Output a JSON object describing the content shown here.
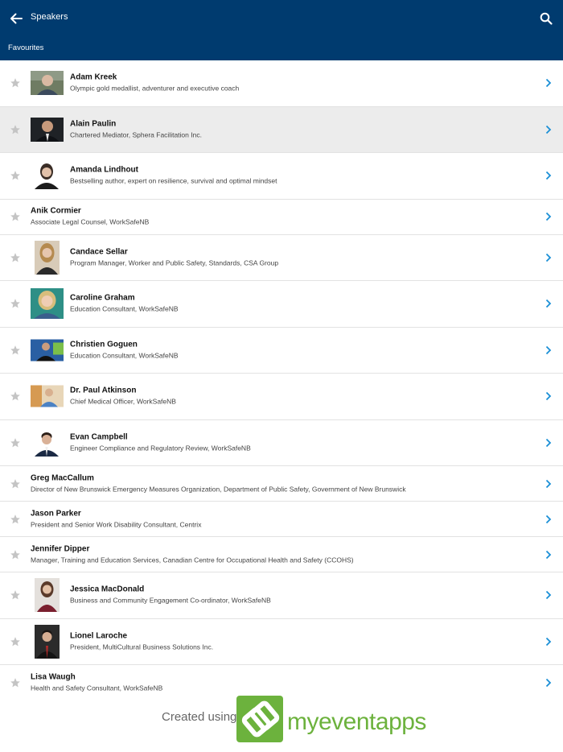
{
  "header": {
    "title": "Speakers",
    "back_icon": "arrow-left-icon",
    "search_icon": "search-icon",
    "background_color": "#003b6f"
  },
  "tab": {
    "label": "Favourites"
  },
  "speakers": [
    {
      "name": "Adam Kreek",
      "title": "Olympic gold medallist, adventurer and executive coach"
    },
    {
      "name": "Alain Paulin",
      "title": "Chartered Mediator, Sphera Facilitation Inc."
    },
    {
      "name": "Amanda Lindhout",
      "title": "Bestselling author, expert on resilience, survival and optimal mindset"
    },
    {
      "name": "Anik Cormier",
      "title": "Associate Legal Counsel, WorkSafeNB"
    },
    {
      "name": "Candace Sellar",
      "title": "Program Manager, Worker and Public Safety, Standards, CSA Group"
    },
    {
      "name": "Caroline Graham",
      "title": "Education Consultant, WorkSafeNB"
    },
    {
      "name": "Christien Goguen",
      "title": "Education Consultant, WorkSafeNB"
    },
    {
      "name": "Dr. Paul Atkinson",
      "title": "Chief Medical Officer, WorkSafeNB"
    },
    {
      "name": "Evan Campbell",
      "title": "Engineer Compliance and Regulatory Review, WorkSafeNB"
    },
    {
      "name": "Greg MacCallum",
      "title": "Director of New Brunswick Emergency Measures Organization, Department of Public Safety, Government of New Brunswick"
    },
    {
      "name": "Jason Parker",
      "title": "President and Senior Work Disability Consultant, Centrix"
    },
    {
      "name": "Jennifer Dipper",
      "title": "Manager, Training and Education Services, Canadian Centre for Occupational Health and Safety (CCOHS)"
    },
    {
      "name": "Jessica MacDonald",
      "title": "Business and Community Engagement Co-ordinator, WorkSafeNB"
    },
    {
      "name": "Lionel Laroche",
      "title": "President, MultiCultural Business Solutions Inc."
    },
    {
      "name": "Lisa Waugh",
      "title": "Health and Safety Consultant, WorkSafeNB"
    }
  ],
  "footer": {
    "created_text": "Created using",
    "brand_text": "myeventapps",
    "brand_color": "#6cb23d"
  },
  "colors": {
    "chevron": "#1a8fd6",
    "star": "#c4c4c4",
    "selected_row": "#ececec"
  }
}
